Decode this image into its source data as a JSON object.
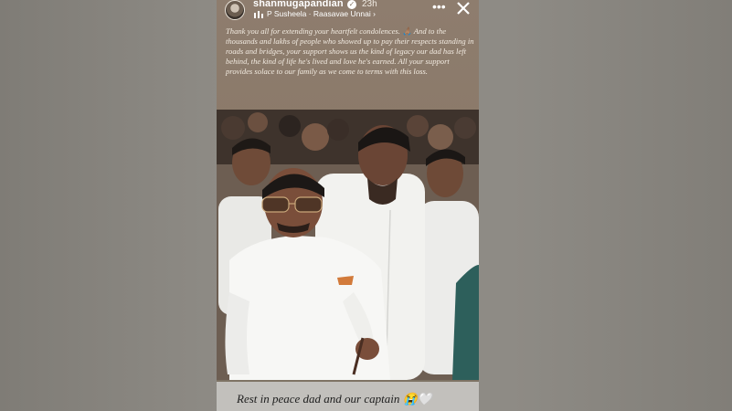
{
  "story": {
    "username": "shanmugapandian",
    "verified_icon": "verified-badge-icon",
    "time_ago": "23h",
    "music": {
      "icon": "music-bars-icon",
      "label": "P Susheela · Raasavae Unnai",
      "chevron": "›"
    },
    "more_label": "•••",
    "caption": "Thank you all for extending your heartfelt condolences. 🙏🏽 And to the thousands and lakhs of people who showed up to pay their respects standing in roads and bridges, your support shows us the kind of legacy our dad has left behind, the kind of life he's lived and love he's earned. All your support provides solace to our family as we come to terms with this loss.",
    "photo_alt": "photo",
    "footer_caption": "Rest in peace dad and our captain 😭🤍"
  },
  "colors": {
    "backdrop": "#8d8a84",
    "story_bg": "#8b7a6a",
    "shirt_white": "#f4f4f2",
    "footer_bg": "#c2c0bc"
  }
}
